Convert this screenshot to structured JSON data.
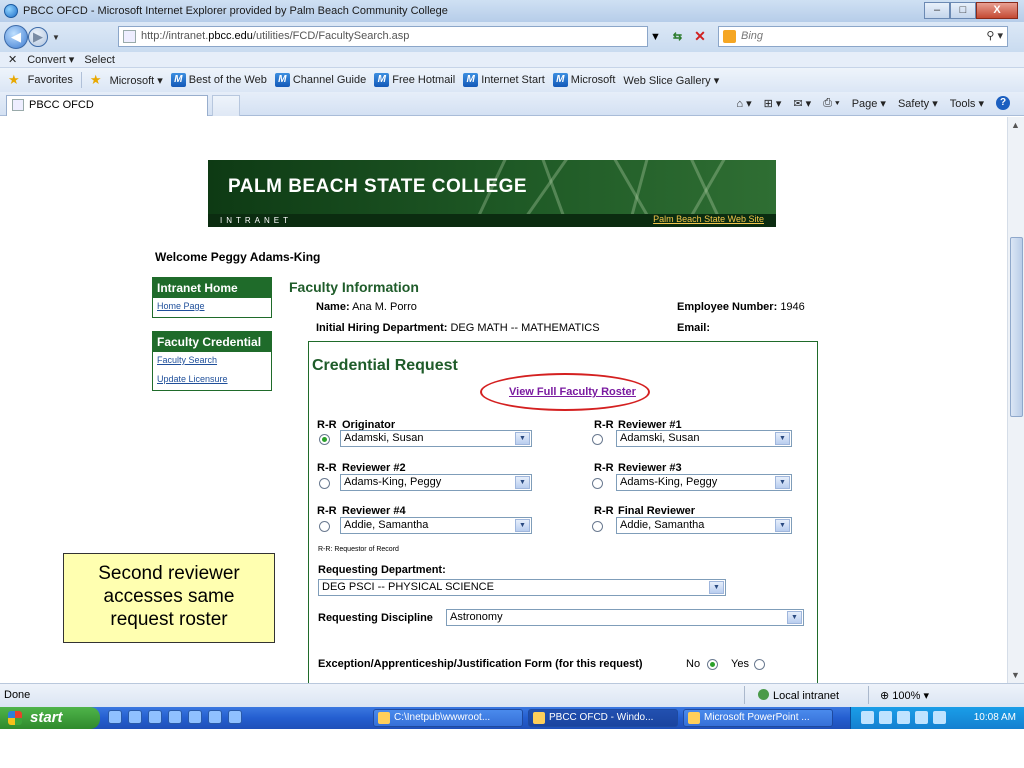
{
  "window": {
    "title": "PBCC OFCD - Microsoft Internet Explorer provided by Palm Beach Community College",
    "min": "–",
    "max": "□",
    "close": "X"
  },
  "address": {
    "url_prefix": "http://intranet.",
    "url_domain": "pbcc.edu",
    "url_path": "/utilities/FCD/FacultySearch.asp",
    "search_placeholder": "Bing",
    "search_icon": "magnifier-icon"
  },
  "cmdbar": {
    "convert": "Convert ▾",
    "select": "Select"
  },
  "favorites": {
    "label": "Favorites",
    "items": [
      "Microsoft ▾",
      "Best of the Web",
      "Channel Guide",
      "Free Hotmail",
      "Internet Start",
      "Microsoft",
      "Web Slice Gallery ▾"
    ]
  },
  "tab": {
    "label": "PBCC OFCD"
  },
  "toolbar": {
    "page": "Page ▾",
    "safety": "Safety ▾",
    "tools": "Tools ▾",
    "help": "?"
  },
  "banner": {
    "title": "PALM BEACH STATE COLLEGE",
    "subtitle": "INTRANET",
    "link": "Palm Beach State Web Site"
  },
  "welcome": "Welcome Peggy Adams-King",
  "nav": {
    "home_header": "Intranet Home",
    "home_link": "Home Page",
    "cred_header": "Faculty Credential",
    "search_link": "Faculty Search",
    "license_link": "Update Licensure"
  },
  "faculty": {
    "title": "Faculty Information",
    "name_label": "Name:",
    "name": "Ana M. Porro",
    "emp_label": "Employee Number:",
    "emp": "1946",
    "dept_label": "Initial Hiring Department:",
    "dept": "DEG MATH -- MATHEMATICS",
    "email_label": "Email:"
  },
  "credential": {
    "title": "Credential Request",
    "roster_link": "View Full Faculty Roster",
    "rr": "R-R",
    "reviewers": [
      {
        "label": "Originator",
        "value": "Adamski, Susan",
        "selected": true
      },
      {
        "label": "Reviewer #1",
        "value": "Adamski, Susan",
        "selected": false
      },
      {
        "label": "Reviewer #2",
        "value": "Adams-King, Peggy",
        "selected": false
      },
      {
        "label": "Reviewer #3",
        "value": "Adams-King, Peggy",
        "selected": false
      },
      {
        "label": "Reviewer #4",
        "value": "Addie, Samantha",
        "selected": false
      },
      {
        "label": "Final Reviewer",
        "value": "Addie, Samantha",
        "selected": false
      }
    ],
    "rr_note": "R-R: Requestor of Record",
    "req_dept_label": "Requesting Department:",
    "req_dept": "DEG PSCI -- PHYSICAL SCIENCE",
    "discipline_label": "Requesting Discipline",
    "discipline": "Astronomy",
    "exception_label": "Exception/Apprenticeship/Justification Form (for this request)",
    "no": "No",
    "yes": "Yes",
    "exception_selected": "No"
  },
  "callout": {
    "line1": "Second reviewer",
    "line2": "accesses same",
    "line3": "request roster"
  },
  "status": {
    "done": "Done",
    "zone": "Local intranet",
    "zoom": "100%"
  },
  "taskbar": {
    "start": "start",
    "items": [
      "C:\\Inetpub\\wwwroot...",
      "PBCC OFCD - Windo...",
      "Microsoft PowerPoint ..."
    ],
    "clock": "10:08 AM"
  }
}
